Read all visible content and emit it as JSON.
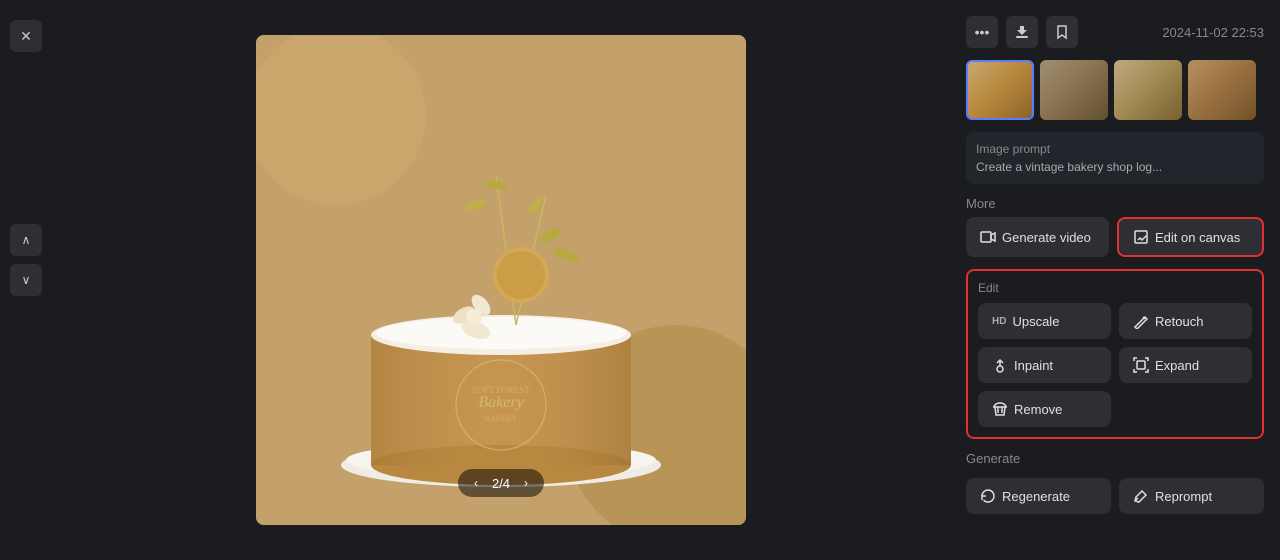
{
  "app": {
    "timestamp": "2024-11-02 22:53",
    "image_counter": "2/4"
  },
  "left_sidebar": {
    "close_label": "✕",
    "up_label": "∧",
    "down_label": "∨"
  },
  "image_nav": {
    "prev": "‹",
    "counter": "2/4",
    "next": "›"
  },
  "top_actions": {
    "more_icon": "•••",
    "download_icon": "↓",
    "bookmark_icon": "♡"
  },
  "image_prompt": {
    "title": "Image prompt",
    "text": "Create a vintage bakery shop log..."
  },
  "more_section": {
    "label": "More",
    "generate_video_label": "Generate video",
    "edit_on_canvas_label": "Edit on canvas"
  },
  "edit_section": {
    "label": "Edit",
    "upscale_label": "Upscale",
    "retouch_label": "Retouch",
    "inpaint_label": "Inpaint",
    "expand_label": "Expand",
    "remove_label": "Remove"
  },
  "generate_section": {
    "label": "Generate",
    "regenerate_label": "Regenerate",
    "reprompt_label": "Reprompt"
  },
  "thumbnails": [
    {
      "id": "thumb1",
      "selected": true
    },
    {
      "id": "thumb2",
      "selected": false
    },
    {
      "id": "thumb3",
      "selected": false
    },
    {
      "id": "thumb4",
      "selected": false
    }
  ]
}
